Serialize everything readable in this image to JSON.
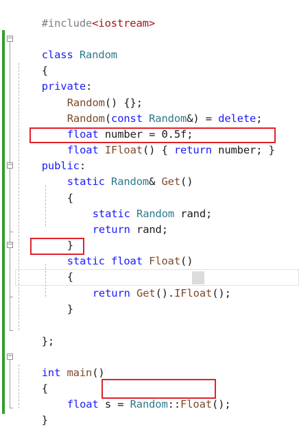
{
  "editor": {
    "lines": {
      "l1": {
        "pre": "#include",
        "hdr_open": "<",
        "hdr": "iostream",
        "hdr_close": ">"
      },
      "l3": {
        "kw": "class",
        "name": "Random"
      },
      "l4": {
        "text": "{"
      },
      "l5": {
        "kw": "private",
        "punc": ":"
      },
      "l6": {
        "fn": "Random",
        "rest": "() {};"
      },
      "l7": {
        "fn": "Random",
        "p1": "(",
        "kw1": "const",
        "type": "Random",
        "p2": "&) = ",
        "kw2": "delete",
        "p3": ";"
      },
      "l8": {
        "kw": "float",
        "rest": " number = 0.5f;"
      },
      "l9": {
        "kw": "float",
        "fn": "IFloat",
        "p1": "() { ",
        "kw2": "return",
        "rest": " number; }"
      },
      "l10": {
        "kw": "public",
        "punc": ":"
      },
      "l11": {
        "kw": "static",
        "type": "Random",
        "amp": "& ",
        "fn": "Get",
        "rest": "()"
      },
      "l12": {
        "text": "{"
      },
      "l13": {
        "kw": "static",
        "type": "Random",
        "rest": " rand;"
      },
      "l14": {
        "kw": "return",
        "rest": " rand;"
      },
      "l15": {
        "text": "}"
      },
      "l16": {
        "kw": "static",
        "kw2": "float",
        "fn": "Float",
        "rest": "()"
      },
      "l17": {
        "text": "{"
      },
      "l18": {
        "kw": "return",
        "fn": "Get",
        "p1": "().",
        "fn2": "IFloat",
        "paren": "()",
        "p2": ";"
      },
      "l19": {
        "text": "}"
      },
      "l21": {
        "text": "};"
      },
      "l23": {
        "kw": "int",
        "fn": "main",
        "rest": "()"
      },
      "l24": {
        "text": "{"
      },
      "l25": {
        "kw": "float",
        "rest": " s = ",
        "type": "Random",
        "p1": "::",
        "fn": "Float",
        "p2": "();"
      },
      "l26": {
        "text": "}"
      }
    },
    "fold_markers": {
      "class": "−",
      "get": "−",
      "float": "−",
      "main": "−"
    }
  },
  "colors": {
    "annotation": "#e0202a",
    "change_bar": "#2f9e2f",
    "keyword": "#1a1aff",
    "type": "#2b7a8a"
  }
}
